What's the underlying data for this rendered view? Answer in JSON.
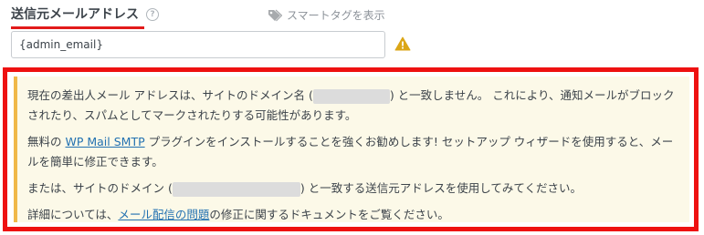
{
  "field": {
    "label": "送信元メールアドレス",
    "help_icon": "question-circle-icon",
    "smart_tag_label": "スマートタグを表示",
    "smart_tag_icon": "tag-icon",
    "input_value": "{admin_email}",
    "warning_icon": "warning-triangle-icon"
  },
  "notice": {
    "p1_before": "現在の差出人メール アドレスは、サイトのドメイン名 (",
    "p1_after": ") と一致しません。 これにより、通知メールがブロックされたり、スパムとしてマークされたりする可能性があります。",
    "p2_before": "無料の ",
    "p2_link": "WP Mail SMTP",
    "p2_after": " プラグインをインストールすることを強くお勧めします! セットアップ ウィザードを使用すると、メールを簡単に修正できます。",
    "p3_before": "または、サイトのドメイン (",
    "p3_after": ") と一致する送信元アドレスを使用してみてください。",
    "p4_before": "詳細については、",
    "p4_link": "メール配信の問題",
    "p4_after": "の修正に関するドキュメントをご覧ください。"
  },
  "colors": {
    "highlight": "#ee1111",
    "notice_bg": "#fcf9e8",
    "notice_border": "#f0b849",
    "link": "#2271b1",
    "warning": "#dba617"
  }
}
